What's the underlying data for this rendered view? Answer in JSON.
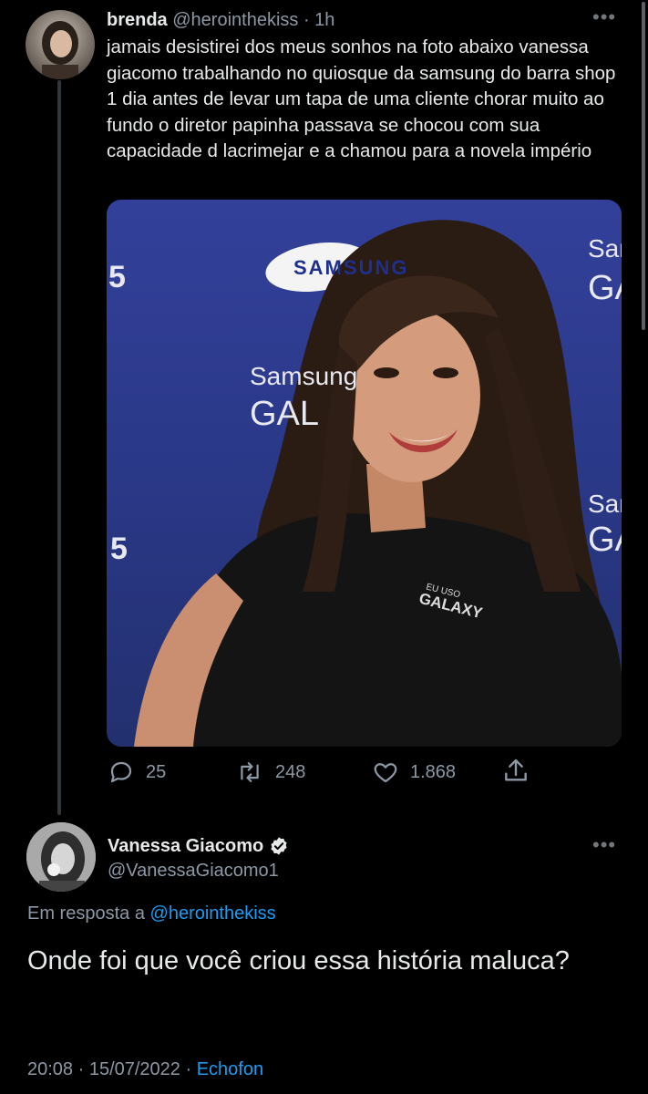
{
  "tweet": {
    "author_name": "brenda",
    "handle": "@herointhekiss",
    "time": "· 1h",
    "text": "jamais desistirei dos meus sonhos na foto abaixo vanessa giacomo trabalhando no quiosque da samsung do barra shop 1 dia antes de levar um tapa de uma cliente chorar muito ao fundo o diretor papinha passava se chocou com sua capacidade d lacrimejar e a chamou para a novela império",
    "more_icon": "more-dots-icon",
    "image": {
      "banner_texts": [
        "SAMSUNG",
        "Samsung",
        "GALAXY",
        "Samsung",
        "GALAXY",
        "Sam",
        "GA",
        "5"
      ],
      "shirt_small": "EU USO",
      "shirt_big": "GALAXY"
    },
    "actions": {
      "replies": "25",
      "retweets": "248",
      "likes": "1.868"
    }
  },
  "reply": {
    "author_name": "Vanessa Giacomo",
    "handle": "@VanessaGiacomo1",
    "verified_icon": "verified-badge-icon",
    "in_reply_to_prefix": "Em resposta a",
    "in_reply_to_handle": "@herointhekiss",
    "text": "Onde foi que você criou essa história maluca?",
    "timestamp": "20:08 · 15/07/2022 ·",
    "client": "Echofon"
  },
  "colors": {
    "background": "#000000",
    "text": "#e7e9ea",
    "muted": "#8b98a5",
    "link": "#1d9bf0",
    "photo_backdrop": "#2c3a8e"
  }
}
